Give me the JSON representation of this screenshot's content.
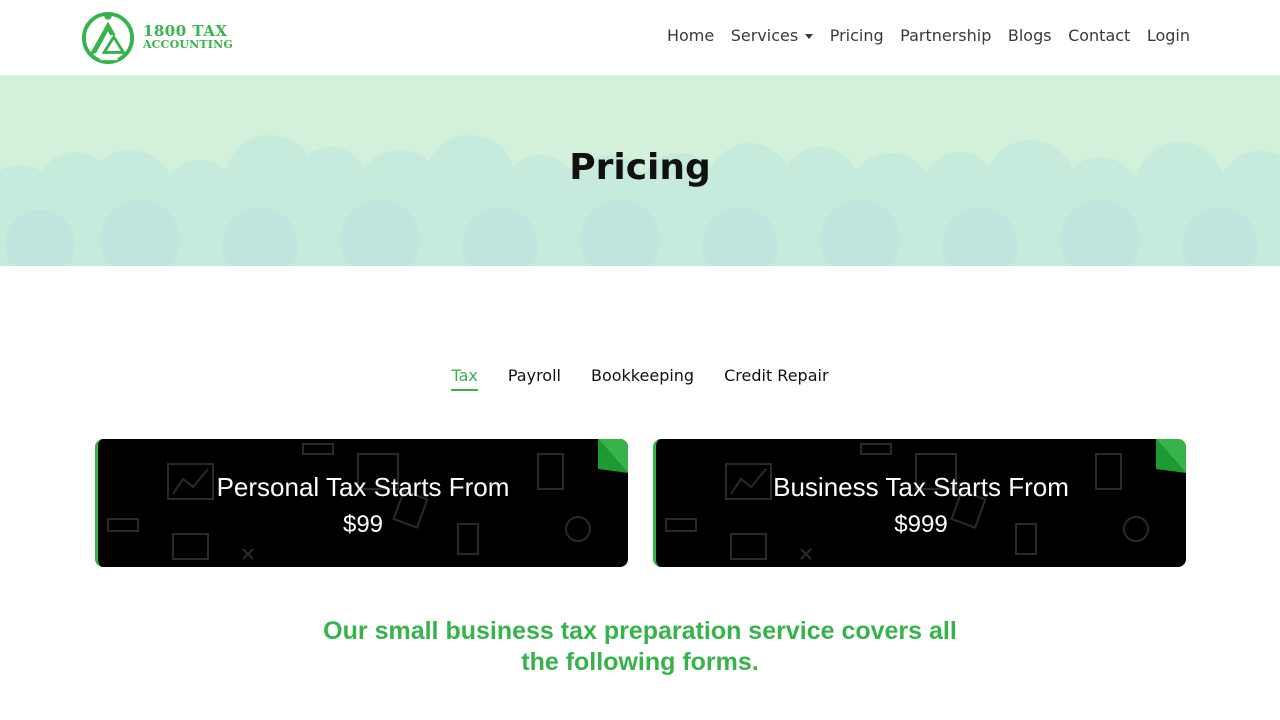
{
  "brand": {
    "line1": "1800 TAX",
    "line2": "ACCOUNTING",
    "color": "#36b34a"
  },
  "nav": {
    "items": [
      {
        "label": "Home"
      },
      {
        "label": "Services",
        "has_dropdown": true
      },
      {
        "label": "Pricing"
      },
      {
        "label": "Partnership"
      },
      {
        "label": "Blogs"
      },
      {
        "label": "Contact"
      },
      {
        "label": "Login"
      }
    ]
  },
  "hero": {
    "title": "Pricing",
    "background": "#d3f1da"
  },
  "tabs": {
    "items": [
      {
        "label": "Tax",
        "active": true
      },
      {
        "label": "Payroll"
      },
      {
        "label": "Bookkeeping"
      },
      {
        "label": "Credit Repair"
      }
    ]
  },
  "cards": [
    {
      "title": "Personal Tax Starts From",
      "price": "$99"
    },
    {
      "title": "Business Tax Starts From",
      "price": "$999"
    }
  ],
  "coverage": {
    "line1": "Our small business tax preparation service covers all",
    "line2": "the following forms."
  }
}
